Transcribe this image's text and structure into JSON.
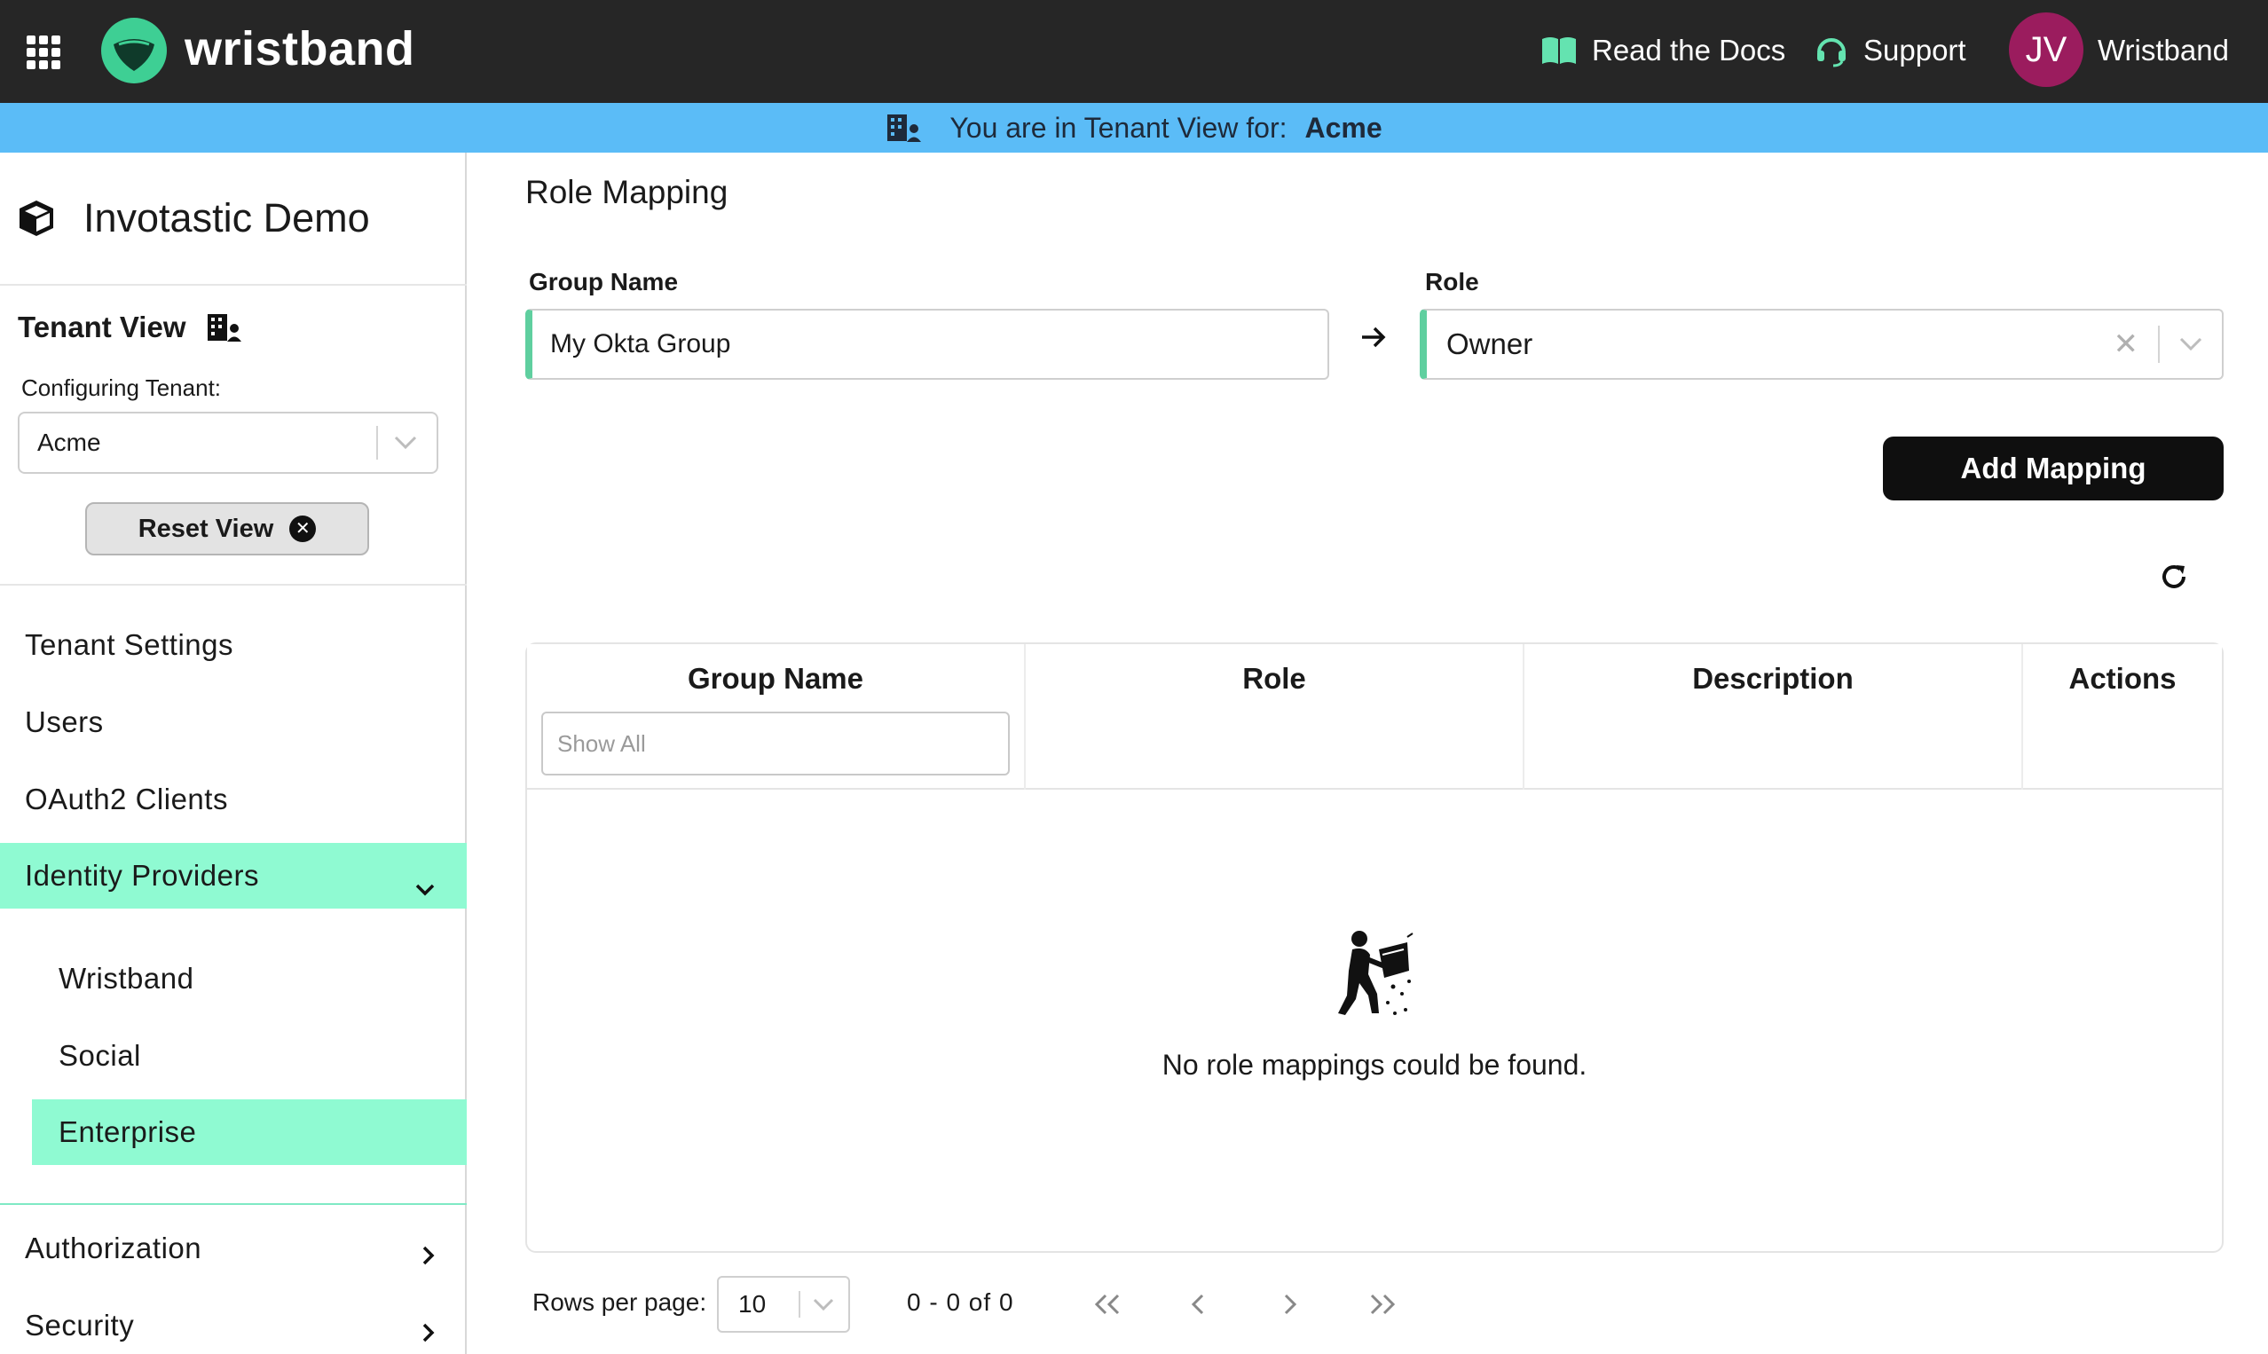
{
  "topbar": {
    "logo_text": "wristband",
    "docs_label": "Read the Docs",
    "support_label": "Support",
    "avatar_initials": "JV",
    "user_name": "Wristband"
  },
  "banner": {
    "label": "You are in Tenant View for:",
    "tenant": "Acme"
  },
  "sidebar": {
    "app_title": "Invotastic Demo",
    "tenant_view_label": "Tenant View",
    "configuring_label": "Configuring Tenant:",
    "tenant_value": "Acme",
    "reset_label": "Reset View",
    "nav": {
      "tenant_settings": "Tenant Settings",
      "users": "Users",
      "oauth2_clients": "OAuth2 Clients",
      "identity_providers": "Identity Providers",
      "authorization": "Authorization",
      "security": "Security"
    },
    "sub_nav": {
      "wristband": "Wristband",
      "social": "Social",
      "enterprise": "Enterprise"
    }
  },
  "main": {
    "page_title": "Role Mapping",
    "group_label": "Group Name",
    "group_value": "My Okta Group",
    "role_label": "Role",
    "role_value": "Owner",
    "add_button": "Add Mapping"
  },
  "table": {
    "columns": [
      "Group Name",
      "Role",
      "Description",
      "Actions"
    ],
    "filter_placeholder": "Show All",
    "empty_message": "No role mappings could be found."
  },
  "pagination": {
    "rows_label": "Rows per page:",
    "rows_value": "10",
    "range": "0 - 0  of  0"
  },
  "colors": {
    "topbar": "#262626",
    "banner": "#5bbcf7",
    "active_nav": "#8ffad2",
    "accent": "#5fcf9f",
    "avatar": "#9b1c5e"
  }
}
